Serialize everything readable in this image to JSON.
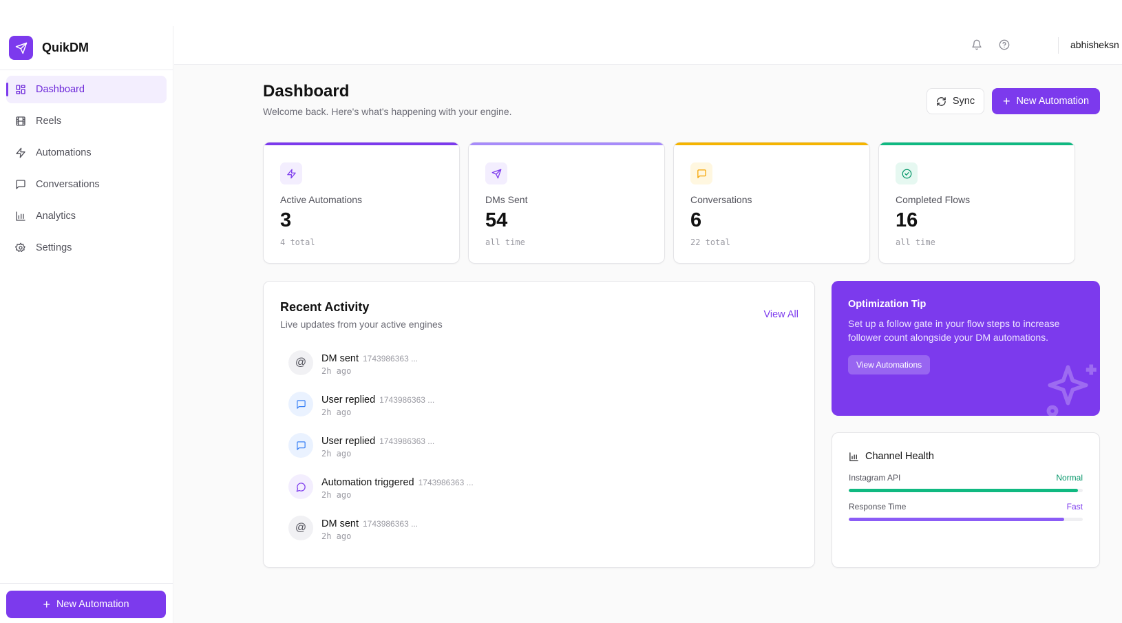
{
  "app": {
    "name": "QuikDM"
  },
  "sidebar": {
    "items": [
      {
        "label": "Dashboard",
        "icon": "dashboard-grid-icon",
        "active": true
      },
      {
        "label": "Reels",
        "icon": "film-icon",
        "active": false
      },
      {
        "label": "Automations",
        "icon": "lightning-icon",
        "active": false
      },
      {
        "label": "Conversations",
        "icon": "message-square-icon",
        "active": false
      },
      {
        "label": "Analytics",
        "icon": "bar-chart-icon",
        "active": false
      },
      {
        "label": "Settings",
        "icon": "gear-icon",
        "active": false
      }
    ],
    "new_automation_label": "New Automation"
  },
  "topbar": {
    "username": "abhisheksn"
  },
  "header": {
    "title": "Dashboard",
    "subtitle": "Welcome back. Here's what's happening with your engine.",
    "sync_label": "Sync",
    "new_automation_label": "New Automation"
  },
  "stats": [
    {
      "label": "Active Automations",
      "value": "3",
      "sub": "4 total",
      "icon": "lightning-icon",
      "color": "#7c3aed"
    },
    {
      "label": "DMs Sent",
      "value": "54",
      "sub": "all time",
      "icon": "send-icon",
      "color": "#a78bfa"
    },
    {
      "label": "Conversations",
      "value": "6",
      "sub": "22 total",
      "icon": "message-square-icon",
      "color": "#f5b400"
    },
    {
      "label": "Completed Flows",
      "value": "16",
      "sub": "all time",
      "icon": "check-circle-icon",
      "color": "#10b981"
    }
  ],
  "activity": {
    "title": "Recent Activity",
    "subtitle": "Live updates from your active engines",
    "view_all_label": "View All",
    "items": [
      {
        "title": "DM sent",
        "id": "1743986363 ...",
        "time": "2h ago",
        "icon": "at-sign-icon"
      },
      {
        "title": "User replied",
        "id": "1743986363 ...",
        "time": "2h ago",
        "icon": "message-square-icon"
      },
      {
        "title": "User replied",
        "id": "1743986363 ...",
        "time": "2h ago",
        "icon": "message-square-icon"
      },
      {
        "title": "Automation triggered",
        "id": "1743986363 ...",
        "time": "2h ago",
        "icon": "message-circle-icon"
      },
      {
        "title": "DM sent",
        "id": "1743986363 ...",
        "time": "2h ago",
        "icon": "at-sign-icon"
      }
    ]
  },
  "tip": {
    "title": "Optimization Tip",
    "body": "Set up a follow gate in your flow steps to increase follower count alongside your DM automations.",
    "button_label": "View Automations"
  },
  "health": {
    "title": "Channel Health",
    "metrics": [
      {
        "label": "Instagram API",
        "status": "Normal",
        "status_color": "#059669",
        "bar_color": "#10b981",
        "level_percent": 98
      },
      {
        "label": "Response Time",
        "status": "Fast",
        "status_color": "#7c3aed",
        "bar_color": "#8b5cf6",
        "level_percent": 92
      }
    ]
  },
  "colors": {
    "accent": "#7c3aed",
    "accent_soft": "#f3eefe"
  }
}
